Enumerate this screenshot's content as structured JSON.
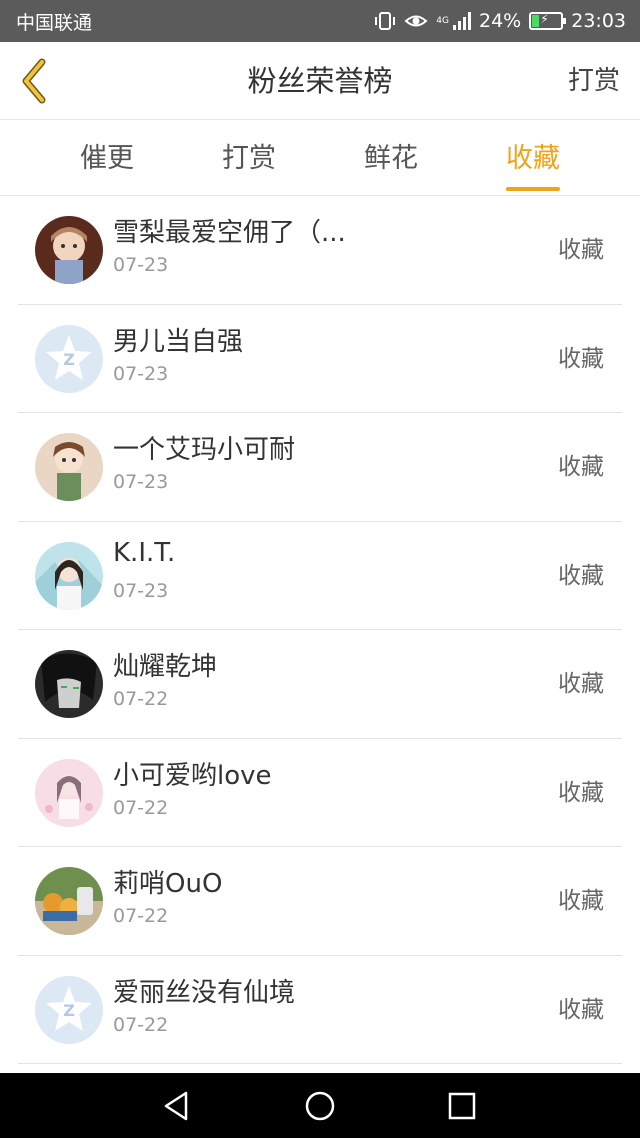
{
  "status_bar": {
    "carrier": "中国联通",
    "network": "4G",
    "battery": "24%",
    "time": "23:03",
    "icons": [
      "vibrate-icon",
      "eye-icon",
      "signal-icon",
      "battery-icon"
    ]
  },
  "header": {
    "title": "粉丝荣誉榜",
    "right_action": "打赏",
    "back_icon": "chevron-left-icon"
  },
  "tabs": [
    {
      "label": "催更",
      "active": false
    },
    {
      "label": "打赏",
      "active": false
    },
    {
      "label": "鲜花",
      "active": false
    },
    {
      "label": "收藏",
      "active": true
    }
  ],
  "colors": {
    "accent": "#f0a31c",
    "status_bar": "#5b5b5b",
    "nav_bar": "#000000"
  },
  "fans": [
    {
      "name": "雪梨最爱空佣了（...",
      "date": "07-23",
      "action": "收藏",
      "avatar": "anime-girl-avatar"
    },
    {
      "name": "男儿当自强",
      "date": "07-23",
      "action": "收藏",
      "avatar": "default-qq-avatar"
    },
    {
      "name": "一个艾玛小可耐",
      "date": "07-23",
      "action": "收藏",
      "avatar": "anime-girl-avatar"
    },
    {
      "name": "K.I.T.",
      "date": "07-23",
      "action": "收藏",
      "avatar": "photo-avatar"
    },
    {
      "name": "灿耀乾坤",
      "date": "07-22",
      "action": "收藏",
      "avatar": "dark-anime-avatar"
    },
    {
      "name": "小可爱哟love",
      "date": "07-22",
      "action": "收藏",
      "avatar": "pink-anime-avatar"
    },
    {
      "name": "莉哨OuO",
      "date": "07-22",
      "action": "收藏",
      "avatar": "food-photo-avatar"
    },
    {
      "name": "爱丽丝没有仙境",
      "date": "07-22",
      "action": "收藏",
      "avatar": "default-qq-avatar"
    }
  ],
  "nav_bar": {
    "buttons": [
      "back-triangle-icon",
      "home-circle-icon",
      "recents-square-icon"
    ]
  }
}
